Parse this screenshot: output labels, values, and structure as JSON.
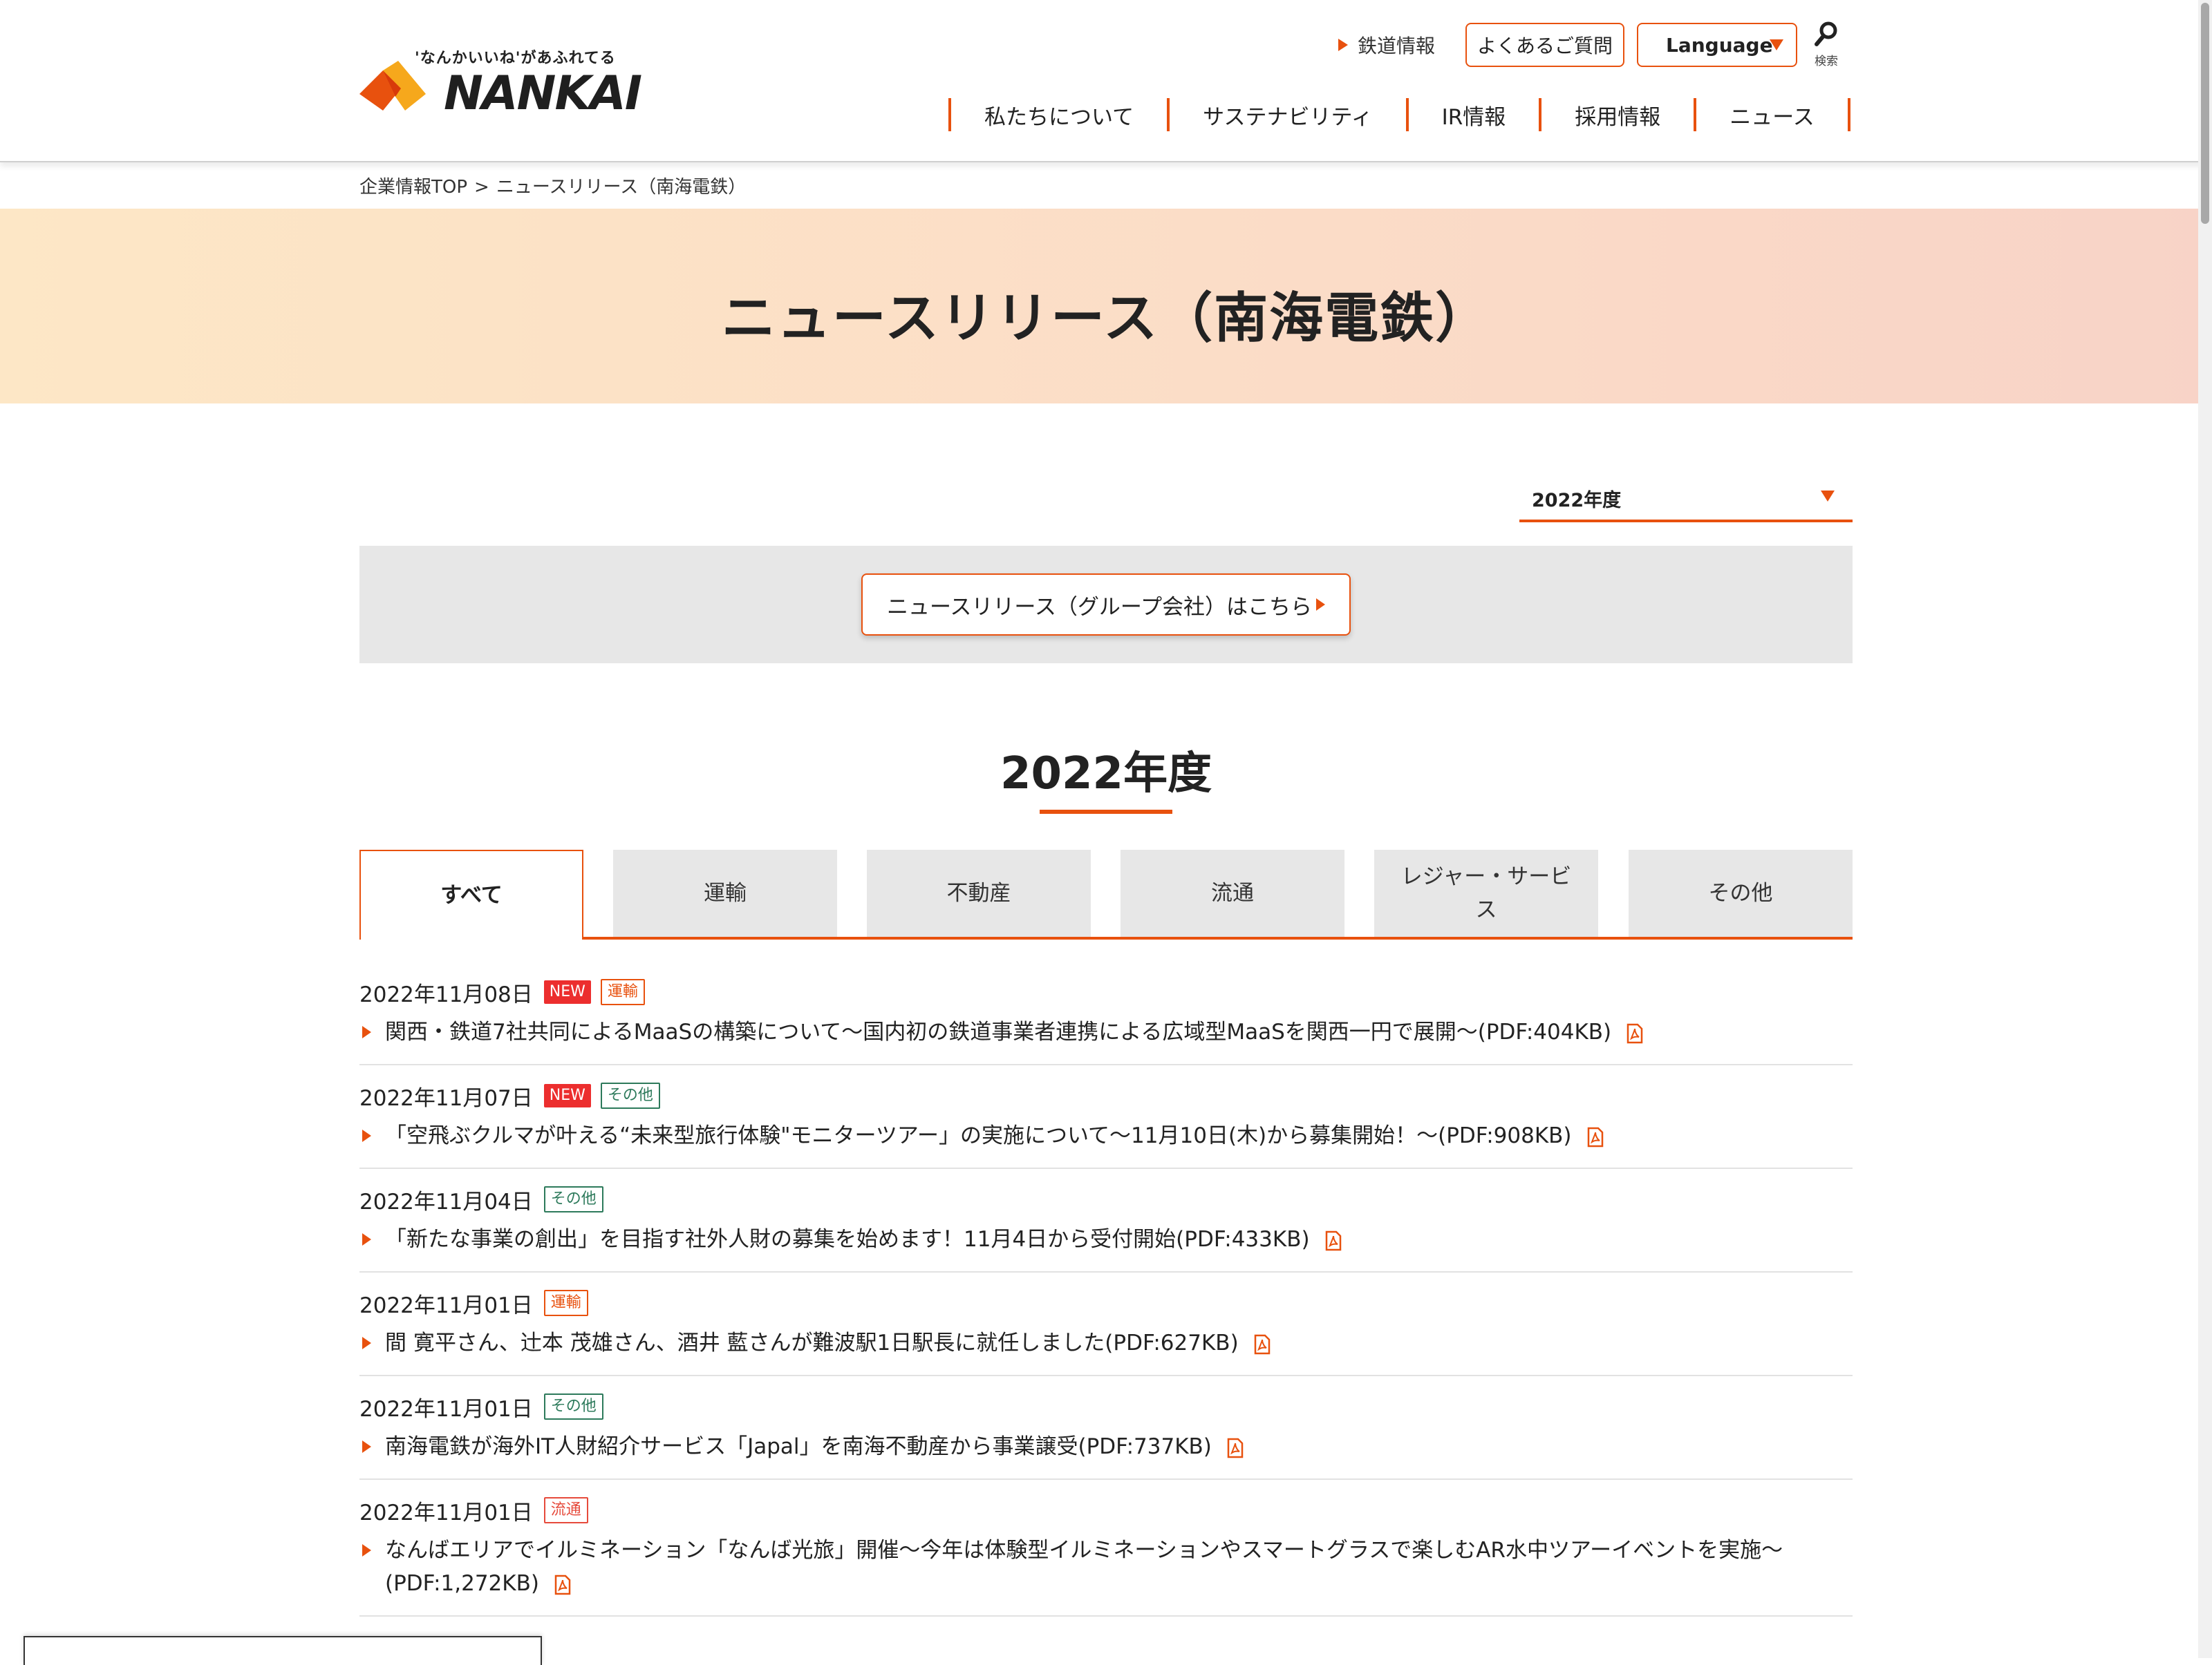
{
  "header": {
    "logo_tagline": "'なんかいいね'があふれてる",
    "logo_word": "NANKAI",
    "rail_link": "鉄道情報",
    "faq_button": "よくあるご質問",
    "language_button": "Language",
    "search_label": "検索",
    "nav": [
      "私たちについて",
      "サステナビリティ",
      "IR情報",
      "採用情報",
      "ニュース"
    ],
    "accent_color": "#e8510e"
  },
  "breadcrumb": {
    "home": "企業情報TOP",
    "separator": ">",
    "current": "ニュースリリース（南海電鉄）"
  },
  "hero": {
    "title": "ニュースリリース（南海電鉄）"
  },
  "year_select": {
    "value": "2022年度"
  },
  "group_link": {
    "label": "ニュースリリース（グループ会社）はこちら"
  },
  "year_heading": "2022年度",
  "tabs": [
    {
      "label": "すべて",
      "active": true
    },
    {
      "label": "運輸",
      "active": false
    },
    {
      "label": "不動産",
      "active": false
    },
    {
      "label": "流通",
      "active": false
    },
    {
      "label": "レジャー・サービス",
      "active": false
    },
    {
      "label": "その他",
      "active": false
    }
  ],
  "news": [
    {
      "date": "2022年11月08日",
      "new": "NEW",
      "category": "運輸",
      "title": "関西・鉄道7社共同によるMaaSの構築について～国内初の鉄道事業者連携による広域型MaaSを関西一円で展開～(PDF:404KB)"
    },
    {
      "date": "2022年11月07日",
      "new": "NEW",
      "category": "その他",
      "title": "「空飛ぶクルマが叶える“未来型旅行体験\"モニターツアー」の実施について～11月10日(木)から募集開始！～(PDF:908KB)"
    },
    {
      "date": "2022年11月04日",
      "new": null,
      "category": "その他",
      "title": "「新たな事業の創出」を目指す社外人財の募集を始めます！11月4日から受付開始(PDF:433KB)"
    },
    {
      "date": "2022年11月01日",
      "new": null,
      "category": "運輸",
      "title": "間 寛平さん、辻本 茂雄さん、酒井 藍さんが難波駅1日駅長に就任しました(PDF:627KB)"
    },
    {
      "date": "2022年11月01日",
      "new": null,
      "category": "その他",
      "title": "南海電鉄が海外IT人財紹介サービス「Japal」を南海不動産から事業譲受(PDF:737KB)"
    },
    {
      "date": "2022年11月01日",
      "new": null,
      "category": "流通",
      "title": "なんばエリアでイルミネーション「なんば光旅」開催～今年は体験型イルミネーションやスマートグラスで楽しむAR水中ツアーイベントを実施～(PDF:1,272KB)"
    }
  ]
}
